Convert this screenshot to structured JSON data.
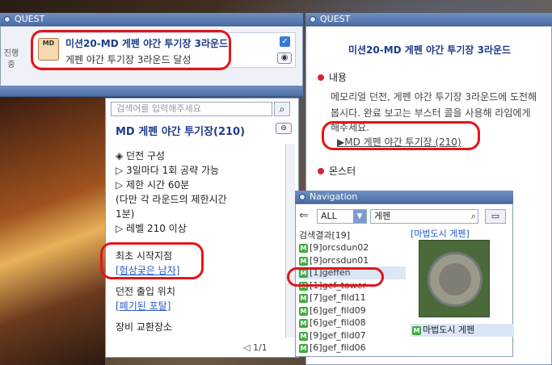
{
  "quest_left": {
    "title": "QUEST",
    "side_tab": "진행중",
    "card": {
      "badge": "MD",
      "title": "미션20-MD 게펜 야간 투기장 3라운드",
      "subtitle": "게펜 야간 투기장 3라운드 달성"
    }
  },
  "md_window": {
    "search_placeholder": "검색어를 입력해주세요",
    "title": "MD 게펜 야간 투기장(210)",
    "lines": [
      "◈ 던전 구성",
      "▷ 3일마다 1회 공략 가능",
      "▷ 제한 시간 60분",
      "  (다만 각 라운드의 제한시간",
      "1분)",
      "▷ 레벨 210 이상"
    ],
    "start_label": "최초 시작지점",
    "start_link": "[험상궂은 남자]",
    "entry_label": "던전 출입 위치",
    "entry_link": "[폐기된 포탈]",
    "exchange_label": "장비 교환장소",
    "pager": "1/1"
  },
  "quest_right": {
    "title": "QUEST",
    "quest_title": "미션20-MD 게펜 야간 투기장 3라운드",
    "content_head": "내용",
    "content_lines": [
      "메모리얼 던전, 게펜 야간 투기장 3라운드에 도전해",
      "봅시다. 완료 보고는 부스터 콜을 사용해 라임에게",
      "해주세요."
    ],
    "link": "▶MD 게펜 야간 투기장 (210)",
    "monster_head": "몬스터"
  },
  "navigation": {
    "title": "Navigation",
    "filter": "ALL",
    "query": "게펜",
    "result_count": "검색결과[19]",
    "items": [
      {
        "label": "[9]orcsdun02",
        "selected": false
      },
      {
        "label": "[9]orcsdun01",
        "selected": false
      },
      {
        "label": "[1]geffen",
        "selected": true
      },
      {
        "label": "[1]gef_tower",
        "selected": false
      },
      {
        "label": "[7]gef_fild11",
        "selected": false
      },
      {
        "label": "[6]gef_fild09",
        "selected": false
      },
      {
        "label": "[6]gef_fild08",
        "selected": false
      },
      {
        "label": "[9]gef_fild07",
        "selected": false
      },
      {
        "label": "[6]gef_fild06",
        "selected": false
      }
    ],
    "map_title": "[마법도시 게펜]",
    "map_item": "마법도시 게펜"
  }
}
